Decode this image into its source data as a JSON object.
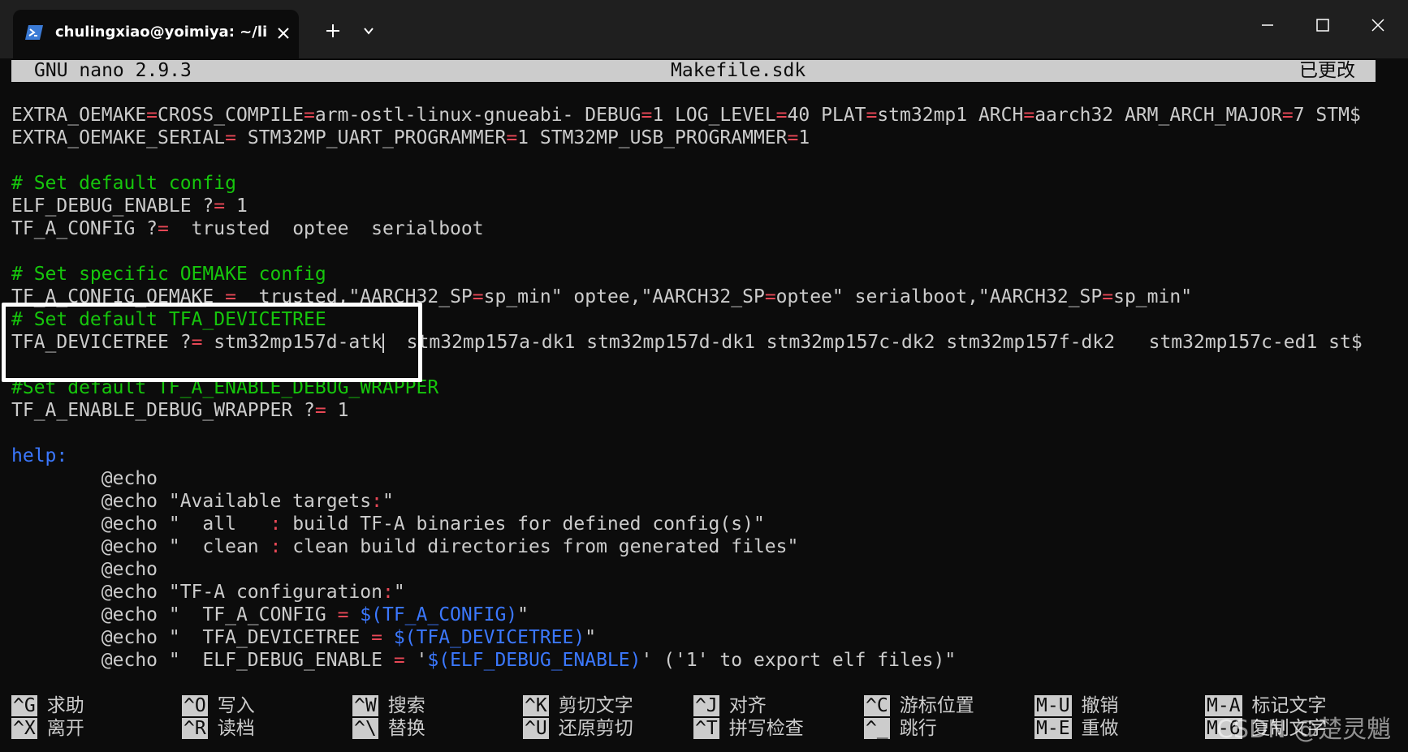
{
  "window": {
    "tab_title": "chulingxiao@yoimiya: ~/linux",
    "accent": "#1f1f1f"
  },
  "nano": {
    "version": "GNU nano 2.9.3",
    "filename": "Makefile.sdk",
    "status": "已更改"
  },
  "lines": {
    "l1": {
      "a": "EXTRA_OEMAKE",
      "b": "CROSS_COMPILE",
      "c": "arm-ostl-linux-gnueabi- DEBUG",
      "d": "1 LOG_LEVEL",
      "e": "40 PLAT",
      "f": "stm32mp1 ARCH",
      "g": "aarch32 ARM_ARCH_MAJOR",
      "h": "7 STM$"
    },
    "l2": {
      "a": "EXTRA_OEMAKE_SERIAL",
      "b": " STM32MP_UART_PROGRAMMER",
      "c": "1 STM32MP_USB_PROGRAMMER",
      "d": "1"
    },
    "l4": {
      "comment": "# Set default config"
    },
    "l5": {
      "a": "ELF_DEBUG_ENABLE ?",
      "b": " 1"
    },
    "l6": {
      "a": "TF_A_CONFIG ?",
      "b": "  trusted  optee  serialboot"
    },
    "l8": {
      "comment": "# Set specific OEMAKE config"
    },
    "l9": {
      "a": "TF_A_CONFIG_OEMAKE ",
      "b": "  trusted,\"AARCH32_SP",
      "c": "sp_min\" optee,\"AARCH32_SP",
      "d": "optee\" serialboot,\"AARCH32_SP",
      "e": "sp_min\""
    },
    "l10": {
      "comment": "# Set default TFA_DEVICETREE"
    },
    "l11": {
      "a": "TFA_DEVICETREE ?",
      "b": " stm32mp157d-atk",
      "c": "  stm32mp157a-dk1 stm32mp157d-dk1 stm32mp157c-dk2 stm32mp157f-dk2   stm32mp157c-ed1 st$"
    },
    "l13": {
      "comment": "#Set default TF_A_ENABLE_DEBUG_WRAPPER"
    },
    "l14": {
      "a": "TF_A_ENABLE_DEBUG_WRAPPER ?",
      "b": " 1"
    },
    "l16": {
      "target": "help:"
    },
    "l17": {
      "a": "        @echo"
    },
    "l18": {
      "a": "        @echo \"Available targets",
      "b": "\""
    },
    "l19": {
      "a": "        @echo \"  all   ",
      "b": " build TF-A binaries for defined config(s)\""
    },
    "l20": {
      "a": "        @echo \"  clean ",
      "b": " clean build directories from generated files\""
    },
    "l21": {
      "a": "        @echo"
    },
    "l22": {
      "a": "        @echo \"TF-A configuration",
      "b": "\""
    },
    "l23": {
      "a": "        @echo \"  TF_A_CONFIG ",
      "b": " $(TF_A_CONFIG)",
      "c": "\""
    },
    "l24": {
      "a": "        @echo \"  TFA_DEVICETREE ",
      "b": " $(TFA_DEVICETREE)",
      "c": "\""
    },
    "l25": {
      "a": "        @echo \"  ELF_DEBUG_ENABLE ",
      "b": " '",
      "c": "$(ELF_DEBUG_ENABLE)",
      "d": "' ('1' to export elf files)\""
    }
  },
  "shortcuts": [
    {
      "key": "^G",
      "label": "求助"
    },
    {
      "key": "^O",
      "label": "写入"
    },
    {
      "key": "^W",
      "label": "搜索"
    },
    {
      "key": "^K",
      "label": "剪切文字"
    },
    {
      "key": "^J",
      "label": "对齐"
    },
    {
      "key": "^C",
      "label": "游标位置"
    },
    {
      "key": "M-U",
      "label": "撤销"
    },
    {
      "key": "M-A",
      "label": "标记文字"
    },
    {
      "key": "^X",
      "label": "离开"
    },
    {
      "key": "^R",
      "label": "读档"
    },
    {
      "key": "^\\",
      "label": "替换"
    },
    {
      "key": "^U",
      "label": "还原剪切"
    },
    {
      "key": "^T",
      "label": "拼写检查"
    },
    {
      "key": "^_",
      "label": "跳行"
    },
    {
      "key": "M-E",
      "label": "重做"
    },
    {
      "key": "M-6",
      "label": "复制文字"
    }
  ],
  "watermark": "CSDN @楚灵魈",
  "colors": {
    "comment": "#16c60c",
    "operator": "#e74856",
    "variable": "#3b78ff",
    "header_bg": "#cccccc",
    "terminal_bg": "#0c0c0c"
  }
}
